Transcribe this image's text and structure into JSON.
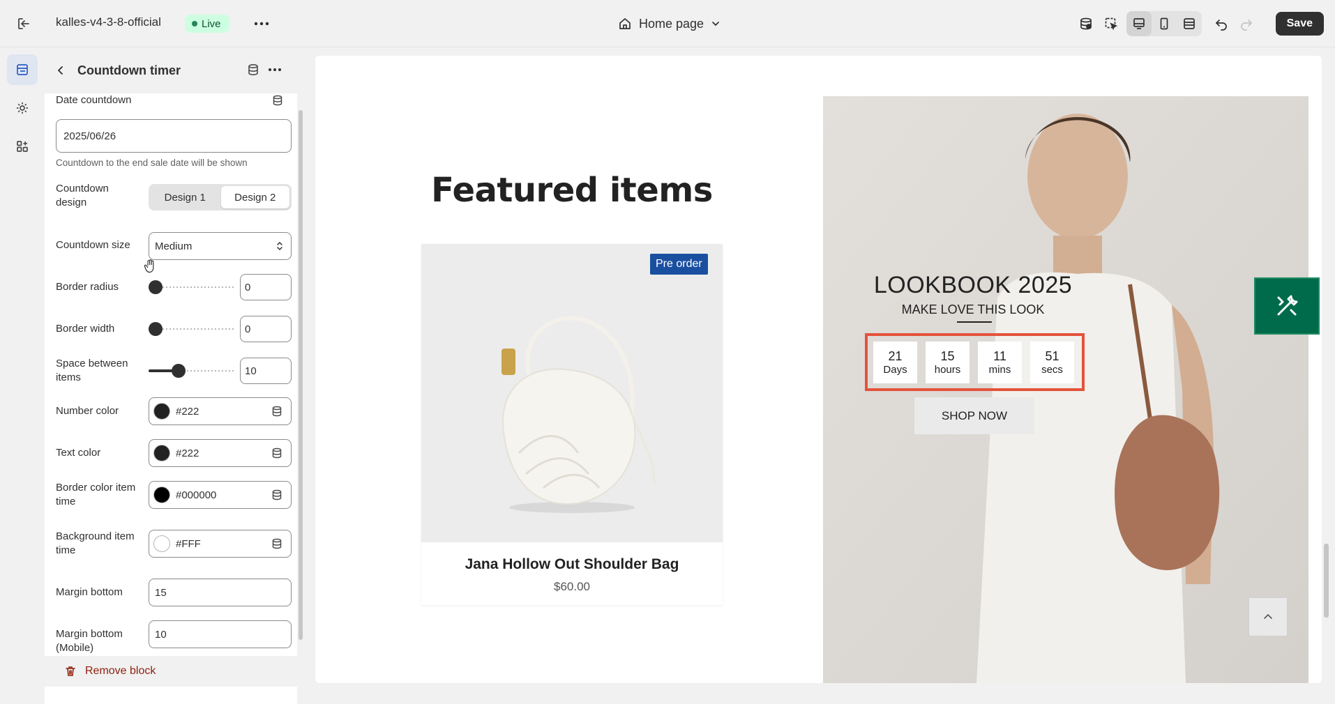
{
  "topbar": {
    "store_name": "kalles-v4-3-8-official",
    "live_badge": "Live",
    "page_selector": "Home page",
    "save_label": "Save"
  },
  "panel": {
    "title": "Countdown timer",
    "date_countdown_label": "Date countdown",
    "date_value": "2025/06/26",
    "date_help": "Countdown to the end sale date will be shown",
    "design_label": "Countdown design",
    "design_options": [
      "Design 1",
      "Design 2"
    ],
    "design_selected": "Design 2",
    "size_label": "Countdown size",
    "size_value": "Medium",
    "border_radius_label": "Border radius",
    "border_radius_value": "0",
    "border_width_label": "Border width",
    "border_width_value": "0",
    "space_label": "Space between items",
    "space_value": "10",
    "number_color_label": "Number color",
    "number_color_value": "#222",
    "text_color_label": "Text color",
    "text_color_value": "#222",
    "border_color_label": "Border color item time",
    "border_color_value": "#000000",
    "bg_item_label": "Background item time",
    "bg_item_value": "#FFF",
    "margin_bottom_label": "Margin bottom",
    "margin_bottom_value": "15",
    "margin_bottom_mobile_label": "Margin bottom (Mobile)",
    "margin_bottom_mobile_value": "10",
    "remove_label": "Remove block"
  },
  "preview": {
    "featured_title": "Featured items",
    "badge": "Pre order",
    "product_name": "Jana Hollow Out Shoulder Bag",
    "product_price": "$60.00",
    "lookbook_title": "LOOKBOOK 2025",
    "lookbook_subtitle": "MAKE LOVE THIS LOOK",
    "countdown": [
      {
        "num": "21",
        "label": "Days"
      },
      {
        "num": "15",
        "label": "hours"
      },
      {
        "num": "11",
        "label": "mins"
      },
      {
        "num": "51",
        "label": "secs"
      }
    ],
    "shop_now": "SHOP NOW"
  },
  "colors": {
    "accent_highlight": "#e4533b",
    "save_bg": "#303030",
    "live_bg": "#cdfee1",
    "preorder_bg": "#1a4fa0",
    "fab_bg": "#006b4a"
  },
  "icons": [
    "exit-icon",
    "more-icon",
    "home-icon",
    "chevron-down-icon",
    "database-icon",
    "inspector-icon",
    "desktop-icon",
    "mobile-icon",
    "fullwidth-icon",
    "undo-icon",
    "redo-icon",
    "sections-icon",
    "settings-icon",
    "apps-icon",
    "back-arrow-icon",
    "select-arrows-icon",
    "trash-icon",
    "tools-icon",
    "chevron-up-icon"
  ]
}
